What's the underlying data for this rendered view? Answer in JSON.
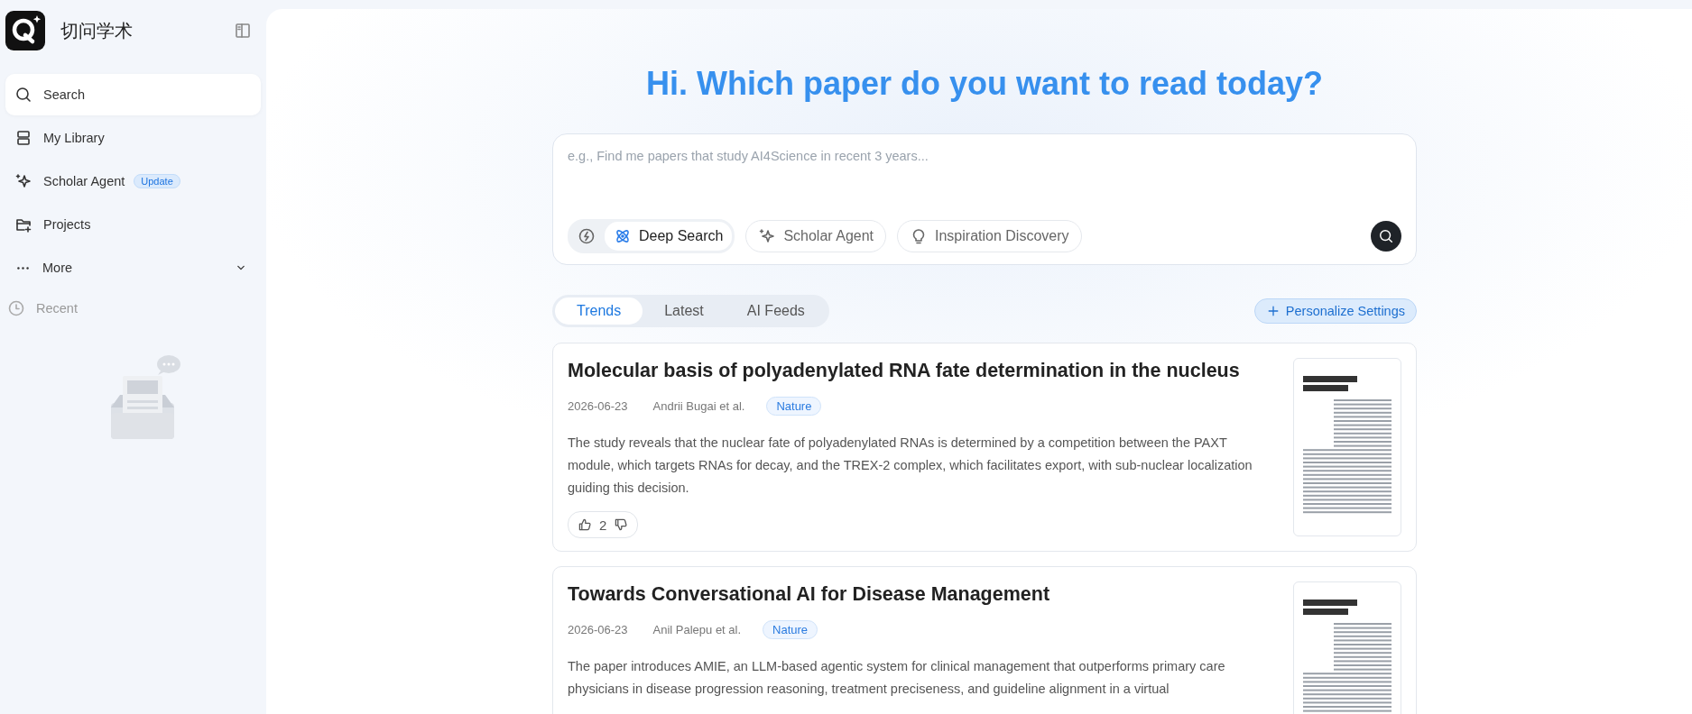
{
  "sidebar": {
    "brand": "切问学术",
    "items": [
      {
        "kind": "search",
        "label": "Search",
        "selected": true
      },
      {
        "kind": "library",
        "label": "My Library",
        "selected": false
      },
      {
        "kind": "agent",
        "label": "Scholar Agent",
        "badge": "Update",
        "selected": false
      },
      {
        "kind": "projects",
        "label": "Projects",
        "selected": false
      },
      {
        "kind": "more",
        "label": "More",
        "selected": false
      }
    ],
    "recent": {
      "label": "Recent"
    }
  },
  "heading": "Hi. Which paper do you want to read today?",
  "search": {
    "placeholder": "e.g., Find me papers that study AI4Science in recent 3 years...",
    "modes": [
      {
        "kind": "quick",
        "selected": false
      },
      {
        "kind": "deep",
        "label": "Deep Search",
        "selected": true
      }
    ],
    "tools": [
      {
        "kind": "agent",
        "label": "Scholar Agent"
      },
      {
        "kind": "bulb",
        "label": "Inspiration Discovery"
      }
    ]
  },
  "tabs": [
    {
      "label": "Trends",
      "selected": true
    },
    {
      "label": "Latest",
      "selected": false
    },
    {
      "label": "AI Feeds",
      "selected": false
    }
  ],
  "personalize": "Personalize Settings",
  "papers": [
    {
      "title": "Molecular basis of polyadenylated RNA fate determination in the nucleus",
      "date": "2026-06-23",
      "authors": "Andrii Bugai et al.",
      "venue": "Nature",
      "summary": "The study reveals that the nuclear fate of polyadenylated RNAs is determined by a competition between the PAXT module, which targets RNAs for decay, and the TREX-2 complex, which facilitates export, with sub-nuclear localization guiding this decision.",
      "likes": "2"
    },
    {
      "title": "Towards Conversational AI for Disease Management",
      "date": "2026-06-23",
      "authors": "Anil Palepu et al.",
      "venue": "Nature",
      "summary": "The paper introduces AMIE, an LLM-based agentic system for clinical management that outperforms primary care physicians in disease progression reasoning, treatment preciseness, and guideline alignment in a virtual"
    }
  ]
}
